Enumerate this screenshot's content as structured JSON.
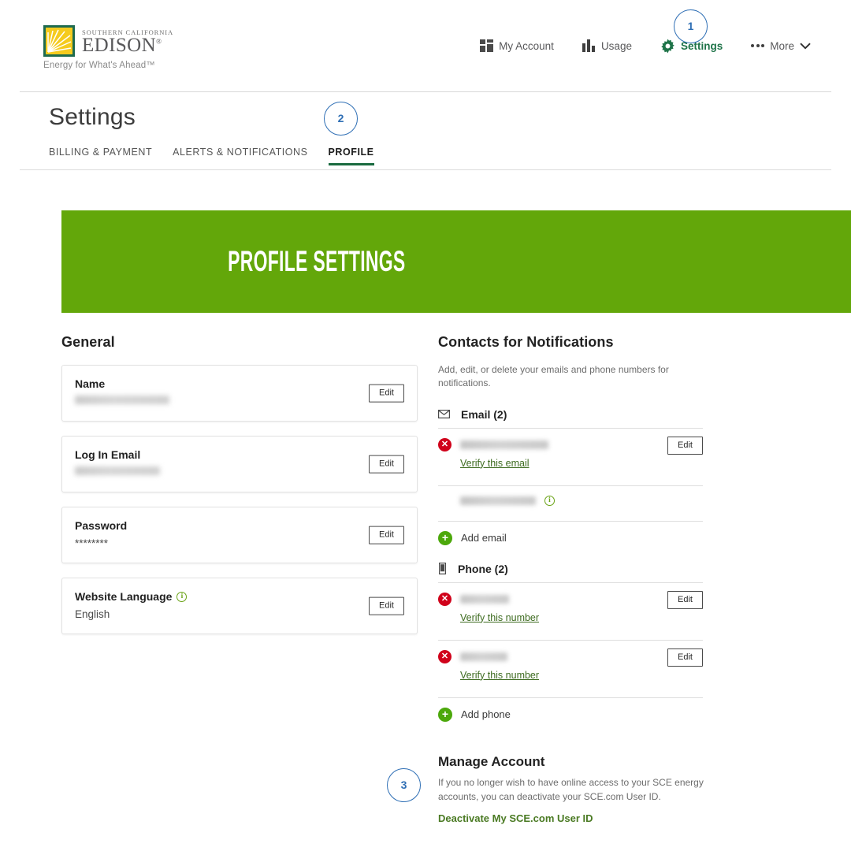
{
  "brand": {
    "logo_small_text": "SOUTHERN CALIFORNIA",
    "logo_name": "EDISON",
    "logo_tagline": "Energy for What's Ahead™",
    "green": "#1e6b4f",
    "gold": "#f3c518"
  },
  "topnav": {
    "items": [
      {
        "label": "My Account",
        "icon": "dashboard-grid-icon",
        "active": false
      },
      {
        "label": "Usage",
        "icon": "bar-chart-icon",
        "active": false
      },
      {
        "label": "Settings",
        "icon": "gear-icon",
        "active": true
      },
      {
        "label": "More",
        "icon": "ellipsis-icon",
        "active": false
      }
    ]
  },
  "header": {
    "title": "Settings",
    "tabs": [
      {
        "label": "BILLING & PAYMENT",
        "active": false
      },
      {
        "label": "ALERTS & NOTIFICATIONS",
        "active": false
      },
      {
        "label": "PROFILE",
        "active": true
      }
    ]
  },
  "banner": {
    "text": "PROFILE SETTINGS",
    "color": "#63a70a"
  },
  "general": {
    "heading": "General",
    "cards": [
      {
        "label": "Name",
        "value": "",
        "redacted": true,
        "redact_width": 120,
        "edit_label": "Edit"
      },
      {
        "label": "Log In Email",
        "value": "",
        "redacted": true,
        "redact_width": 108,
        "edit_label": "Edit"
      },
      {
        "label": "Password",
        "value": "********",
        "redacted": false,
        "edit_label": "Edit"
      },
      {
        "label": "Website Language",
        "value": "English",
        "redacted": false,
        "info": true,
        "edit_label": "Edit"
      }
    ]
  },
  "contacts": {
    "heading": "Contacts for Notifications",
    "description": "Add, edit, or delete your emails and phone numbers for notifications.",
    "email_group": {
      "label": "Email (2)",
      "icon": "envelope-icon",
      "rows": [
        {
          "redact_width": 112,
          "status": "unverified",
          "verify_label": "Verify this email",
          "edit_label": "Edit",
          "has_edit": true,
          "has_info": false
        },
        {
          "redact_width": 96,
          "status": "verified",
          "verify_label": "",
          "edit_label": "",
          "has_edit": false,
          "has_info": true
        }
      ],
      "add_label": "Add email"
    },
    "phone_group": {
      "label": "Phone (2)",
      "icon": "mobile-phone-icon",
      "rows": [
        {
          "redact_width": 62,
          "status": "unverified",
          "verify_label": "Verify this number",
          "edit_label": "Edit",
          "has_edit": true,
          "has_info": false
        },
        {
          "redact_width": 60,
          "status": "unverified",
          "verify_label": "Verify this number",
          "edit_label": "Edit",
          "has_edit": true,
          "has_info": false
        }
      ],
      "add_label": "Add phone"
    }
  },
  "manage_account": {
    "heading": "Manage Account",
    "description": "If you no longer wish to have online access to your SCE energy accounts, you can deactivate your SCE.com User ID.",
    "link_label": "Deactivate My SCE.com User ID"
  },
  "step_badges": [
    {
      "number": "1",
      "target": "settings-nav"
    },
    {
      "number": "2",
      "target": "profile-tab"
    },
    {
      "number": "3",
      "target": "manage-account"
    }
  ]
}
